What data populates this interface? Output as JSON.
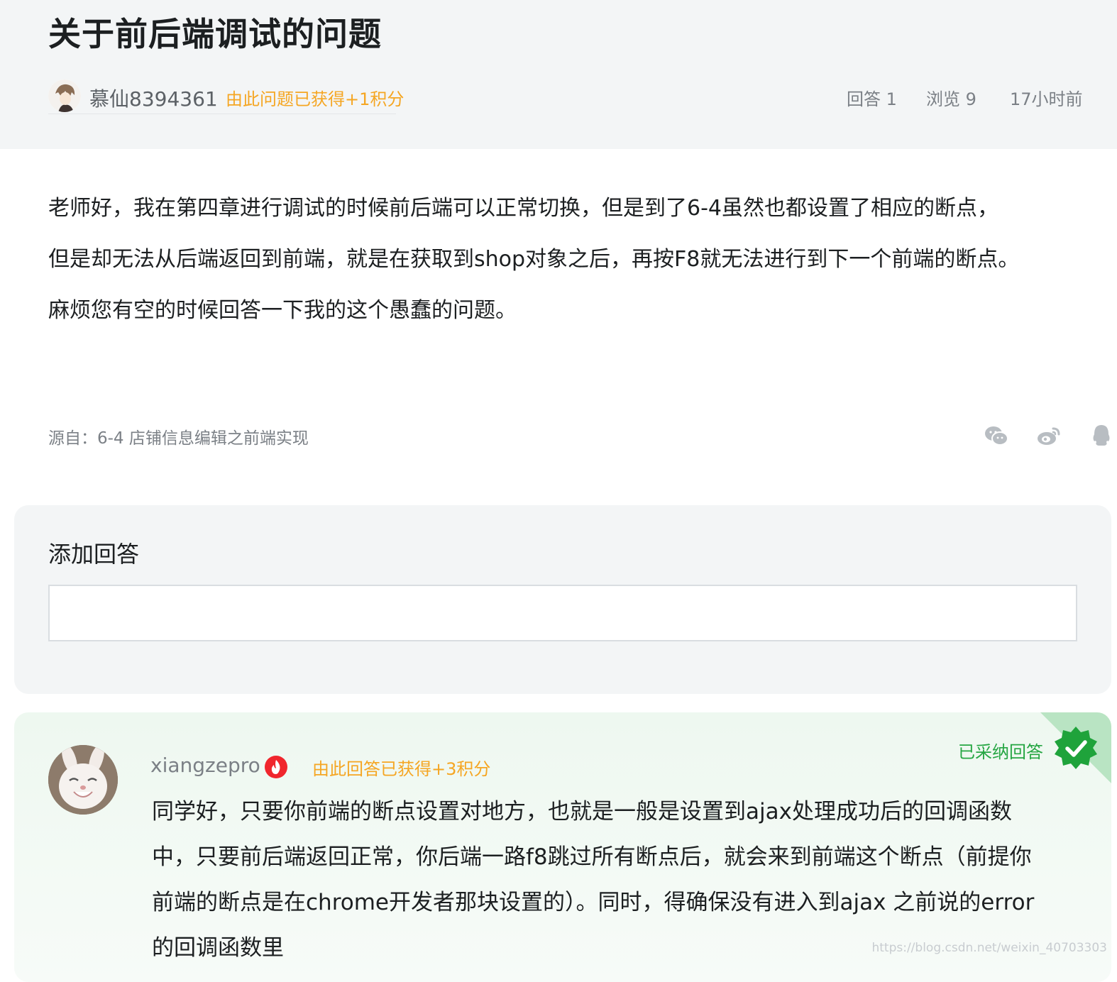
{
  "question": {
    "title": "关于前后端调试的问题",
    "author": {
      "name": "慕仙8394361",
      "points_note": "由此问题已获得+1积分"
    },
    "meta": {
      "answers": "回答 1",
      "views": "浏览 9",
      "time": "17小时前"
    },
    "body": [
      "老师好，我在第四章进行调试的时候前后端可以正常切换，但是到了6-4虽然也都设置了相应的断点，",
      "但是却无法从后端返回到前端，就是在获取到shop对象之后，再按F8就无法进行到下一个前端的断点。",
      "麻烦您有空的时候回答一下我的这个愚蠢的问题。"
    ],
    "source": "源自：6-4 店铺信息编辑之前端实现",
    "share_icons": [
      "wechat-icon",
      "weibo-icon",
      "qq-icon"
    ]
  },
  "add_answer": {
    "title": "添加回答",
    "input_value": ""
  },
  "answer": {
    "author": {
      "name": "xiangzepro",
      "points_note": "由此回答已获得+3积分"
    },
    "accepted_label": "已采纳回答",
    "body": [
      "同学好，只要你前端的断点设置对地方，也就是一般是设置到ajax处理成功后的回调函数",
      "中，只要前后端返回正常，你后端一路f8跳过所有断点后，就会来到前端这个断点（前提你",
      "前端的断点是在chrome开发者那块设置的）。同时，得确保没有进入到ajax 之前说的error",
      "的回调函数里"
    ]
  },
  "watermark": "https://blog.csdn.net/weixin_40703303",
  "colors": {
    "header_bg": "#f3f5f6",
    "points_orange": "#f5a623",
    "accepted_green": "#26a643",
    "answer_card_bg": "#eef8f0"
  }
}
